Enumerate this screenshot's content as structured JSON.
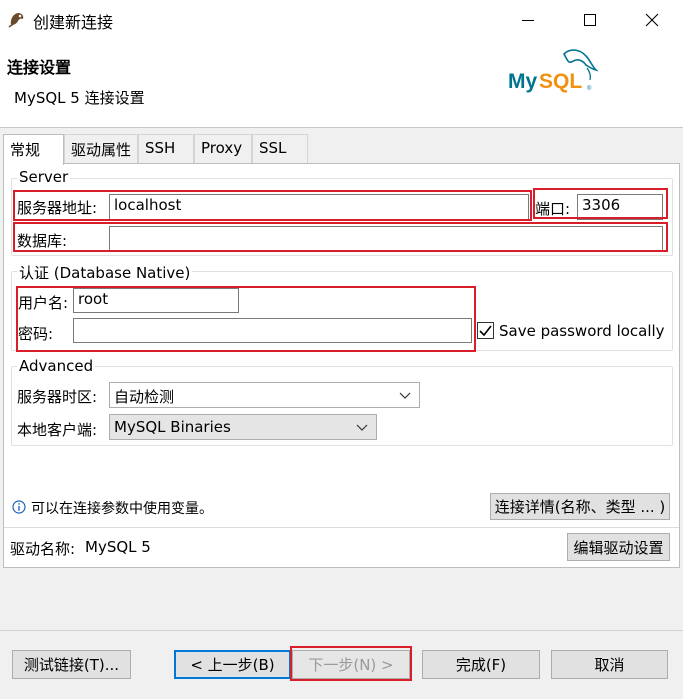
{
  "window": {
    "title": "创建新连接",
    "icons": [
      "app-dbeaver-icon",
      "minimize-icon",
      "maximize-icon",
      "close-icon"
    ]
  },
  "header": {
    "title": "连接设置",
    "subtitle": "MySQL 5 连接设置",
    "logo": "MySQL"
  },
  "tabs": [
    {
      "label": "常规",
      "active": true
    },
    {
      "label": "驱动属性",
      "active": false
    },
    {
      "label": "SSH",
      "active": false
    },
    {
      "label": "Proxy",
      "active": false
    },
    {
      "label": "SSL",
      "active": false
    }
  ],
  "server": {
    "legend": "Server",
    "host_label": "服务器地址:",
    "host_value": "localhost",
    "port_label": "端口:",
    "port_value": "3306",
    "database_label": "数据库:",
    "database_value": ""
  },
  "auth": {
    "legend": "认证 (Database Native)",
    "user_label": "用户名:",
    "user_value": "root",
    "password_label": "密码:",
    "password_value": "",
    "save_password_label": "Save password locally",
    "save_password_checked": true
  },
  "advanced": {
    "legend": "Advanced",
    "timezone_label": "服务器时区:",
    "timezone_value": "自动检测",
    "client_label": "本地客户端:",
    "client_value": "MySQL Binaries"
  },
  "info": {
    "icon": "info-icon",
    "text": "可以在连接参数中使用变量。",
    "details_button": "连接详情(名称、类型 ... )"
  },
  "driver": {
    "label": "驱动名称:",
    "value": "MySQL 5",
    "edit_button": "编辑驱动设置"
  },
  "footer": {
    "test": "测试链接(T)...",
    "back": "< 上一步(B)",
    "next": "下一步(N) >",
    "finish": "完成(F)",
    "cancel": "取消"
  },
  "colors": {
    "highlight": "#d81e28",
    "mysql_blue": "#00758f",
    "mysql_orange": "#f29111",
    "default_button_border": "#0078d7"
  }
}
